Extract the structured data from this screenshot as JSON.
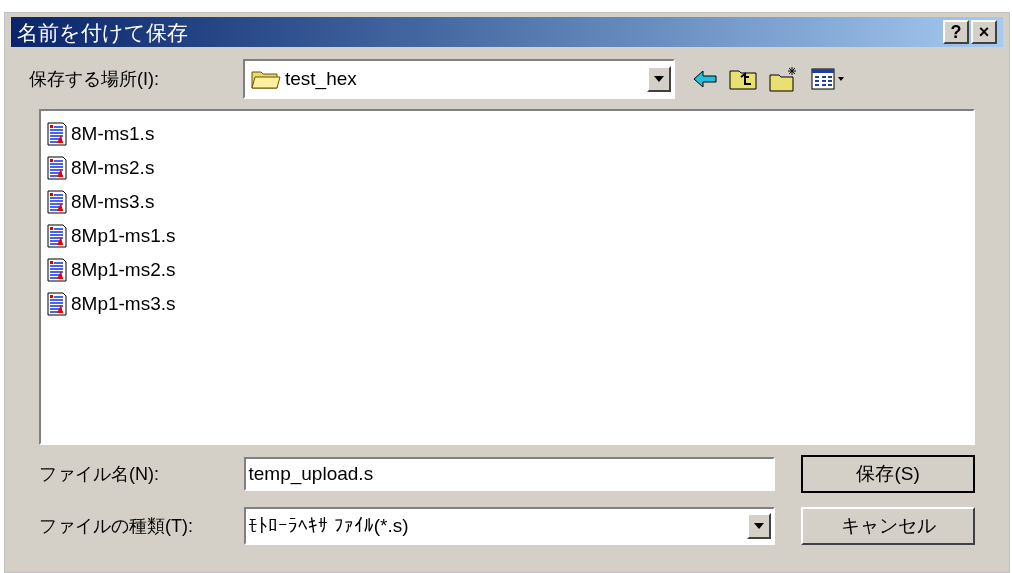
{
  "window": {
    "title": "名前を付けて保存",
    "title_buttons": [
      "?",
      "×"
    ]
  },
  "location": {
    "label": "保存する場所(I):",
    "value": "test_hex"
  },
  "files": [
    {
      "name": "8M-ms1.s"
    },
    {
      "name": "8M-ms2.s"
    },
    {
      "name": "8M-ms3.s"
    },
    {
      "name": "8Mp1-ms1.s"
    },
    {
      "name": "8Mp1-ms2.s"
    },
    {
      "name": "8Mp1-ms3.s"
    }
  ],
  "filename": {
    "label": "ファイル名(N):",
    "value": "temp_upload.s"
  },
  "filetype": {
    "label": "ファイルの種類(T):",
    "value": "ﾓﾄﾛｰﾗﾍｷｻ ﾌｧｲﾙ(*.s)"
  },
  "buttons": [
    "保存(S)",
    "キャンセル"
  ]
}
